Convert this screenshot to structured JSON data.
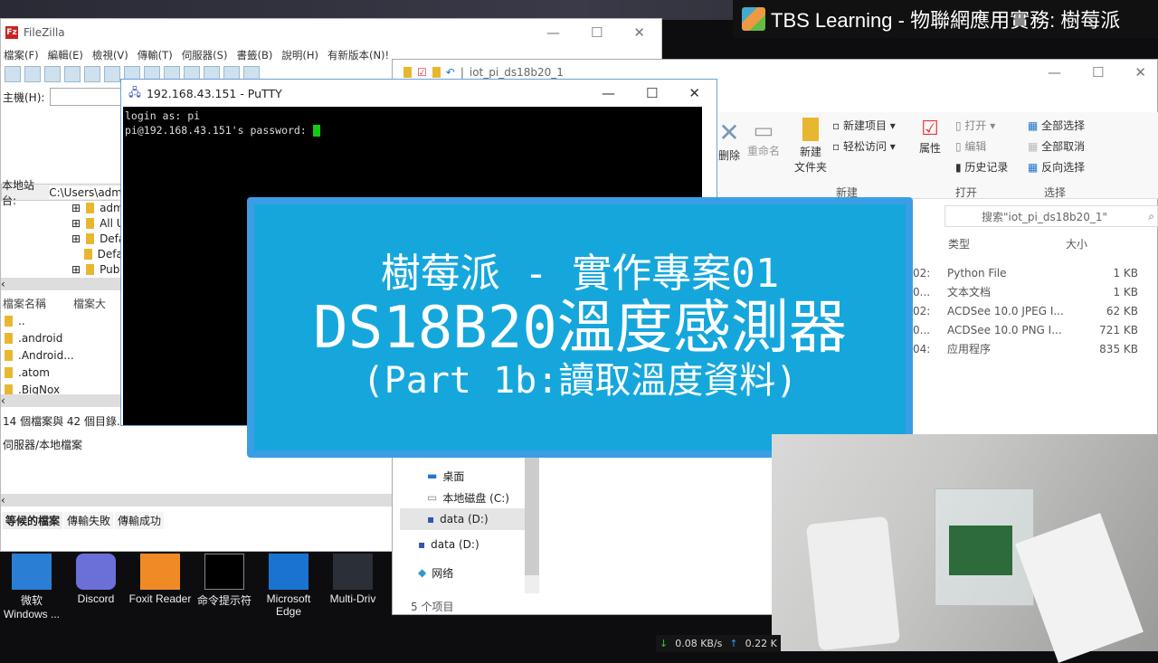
{
  "banner": {
    "title": "TBS Learning - 物聯網應用實務: 樹莓派"
  },
  "filezilla": {
    "title": "FileZilla",
    "menu": [
      "檔案(F)",
      "編輯(E)",
      "檢視(V)",
      "傳輸(T)",
      "伺服器(S)",
      "書籤(B)",
      "說明(H)",
      "有新版本(N)!"
    ],
    "host_label": "主機(H):",
    "local_site_label": "本地站台:",
    "local_site_value": "C:\\Users\\adm",
    "tree": [
      "adm",
      "All U",
      "Defa",
      "Defa",
      "Pub"
    ],
    "columns": [
      "檔案名稱",
      "檔案大"
    ],
    "files": [
      "..",
      ".android",
      ".Android...",
      ".atom",
      ".BigNox"
    ],
    "status": "14 個檔案與 42 個目錄. 總",
    "queue_header": "伺服器/本地檔案",
    "tabs": [
      "等候的檔案",
      "傳輸失敗",
      "傳輸成功"
    ]
  },
  "putty": {
    "title": "192.168.43.151 - PuTTY",
    "line1": "login as: pi",
    "line2": "pi@192.168.43.151's password: "
  },
  "explorer": {
    "title": "iot_pi_ds18b20_1",
    "ribbon": {
      "delete": "删除",
      "rename": "重命名",
      "new_folder": "新建\n文件夹",
      "new_item": "新建项目",
      "easy_access": "轻松访问",
      "properties": "属性",
      "open": "打开",
      "edit": "编辑",
      "history": "历史记录",
      "select_all": "全部选择",
      "select_none": "全部取消",
      "invert": "反向选择",
      "groups": [
        "新建",
        "打开",
        "选择"
      ]
    },
    "search_placeholder": "搜索\"iot_pi_ds18b20_1\"",
    "columns": [
      "类型",
      "大小"
    ],
    "files": [
      {
        "date": "02:",
        "type": "Python File",
        "size": "1 KB"
      },
      {
        "date": "0...",
        "type": "文本文档",
        "size": "1 KB"
      },
      {
        "date": "02:",
        "type": "ACDSee 10.0 JPEG I...",
        "size": "62 KB"
      },
      {
        "date": "0...",
        "type": "ACDSee 10.0 PNG I...",
        "size": "721 KB"
      },
      {
        "date": "04:",
        "type": "应用程序",
        "size": "835 KB"
      }
    ],
    "nav": [
      "桌面",
      "本地磁盘 (C:)",
      "data (D:)",
      "data (D:)",
      "网络"
    ],
    "status": "5 个项目"
  },
  "card": {
    "line1": "樹莓派 - 實作專案01",
    "line2": "DS18B20溫度感測器",
    "line3": "(Part 1b:讀取溫度資料)"
  },
  "desktop_icons": [
    "微软\nWindows ...",
    "Discord",
    "Foxit Reader",
    "命令提示符",
    "Microsoft\nEdge",
    "Multi-Driv"
  ],
  "netspeed": {
    "down": "0.08 KB/s",
    "up": "0.22 K"
  }
}
